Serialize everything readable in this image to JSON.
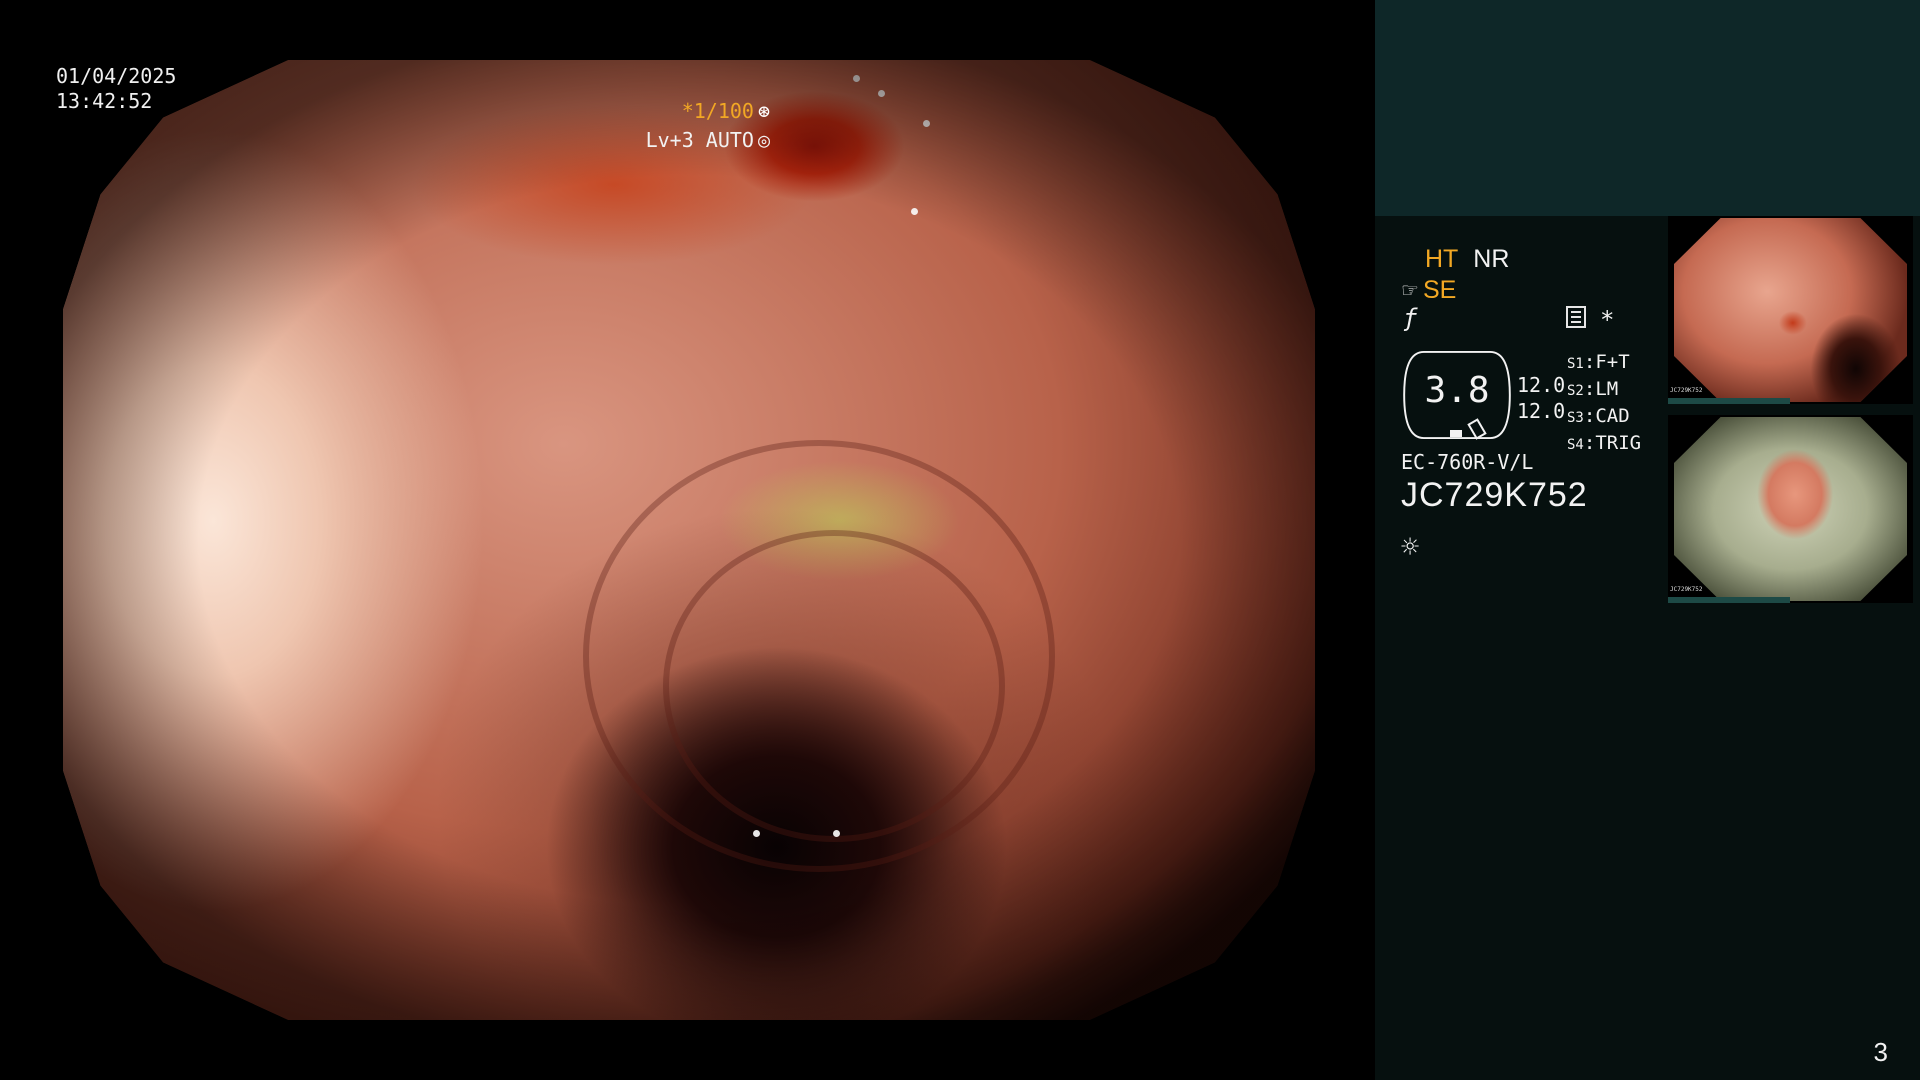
{
  "overlay": {
    "date": "01/04/2025",
    "time": "13:42:52",
    "shutter": "*1/100",
    "iris": "Lv+3 AUTO"
  },
  "panel": {
    "ht": "HT",
    "nr": "NR",
    "se": "SE",
    "gauge_value": "3.8",
    "values": [
      "12.0",
      "12.0"
    ],
    "slots": [
      {
        "key": "S1",
        "value": "F+T"
      },
      {
        "key": "S2",
        "value": "LM"
      },
      {
        "key": "S3",
        "value": "CAD"
      },
      {
        "key": "S4",
        "value": "TRIG"
      }
    ],
    "model": "EC-760R-V/L",
    "serial": "JC729K752",
    "thumbnails": [
      {
        "caption": "JC729K752"
      },
      {
        "caption": "JC729K752"
      }
    ]
  },
  "page_number": "3",
  "colors": {
    "accent": "#f2a824",
    "panel_bg": "#06100f",
    "panel_top": "#0e2728"
  },
  "icons": [
    "shutter-icon",
    "iris-icon",
    "hand-icon",
    "f-icon",
    "menu-icon",
    "star-icon",
    "light-icon"
  ]
}
